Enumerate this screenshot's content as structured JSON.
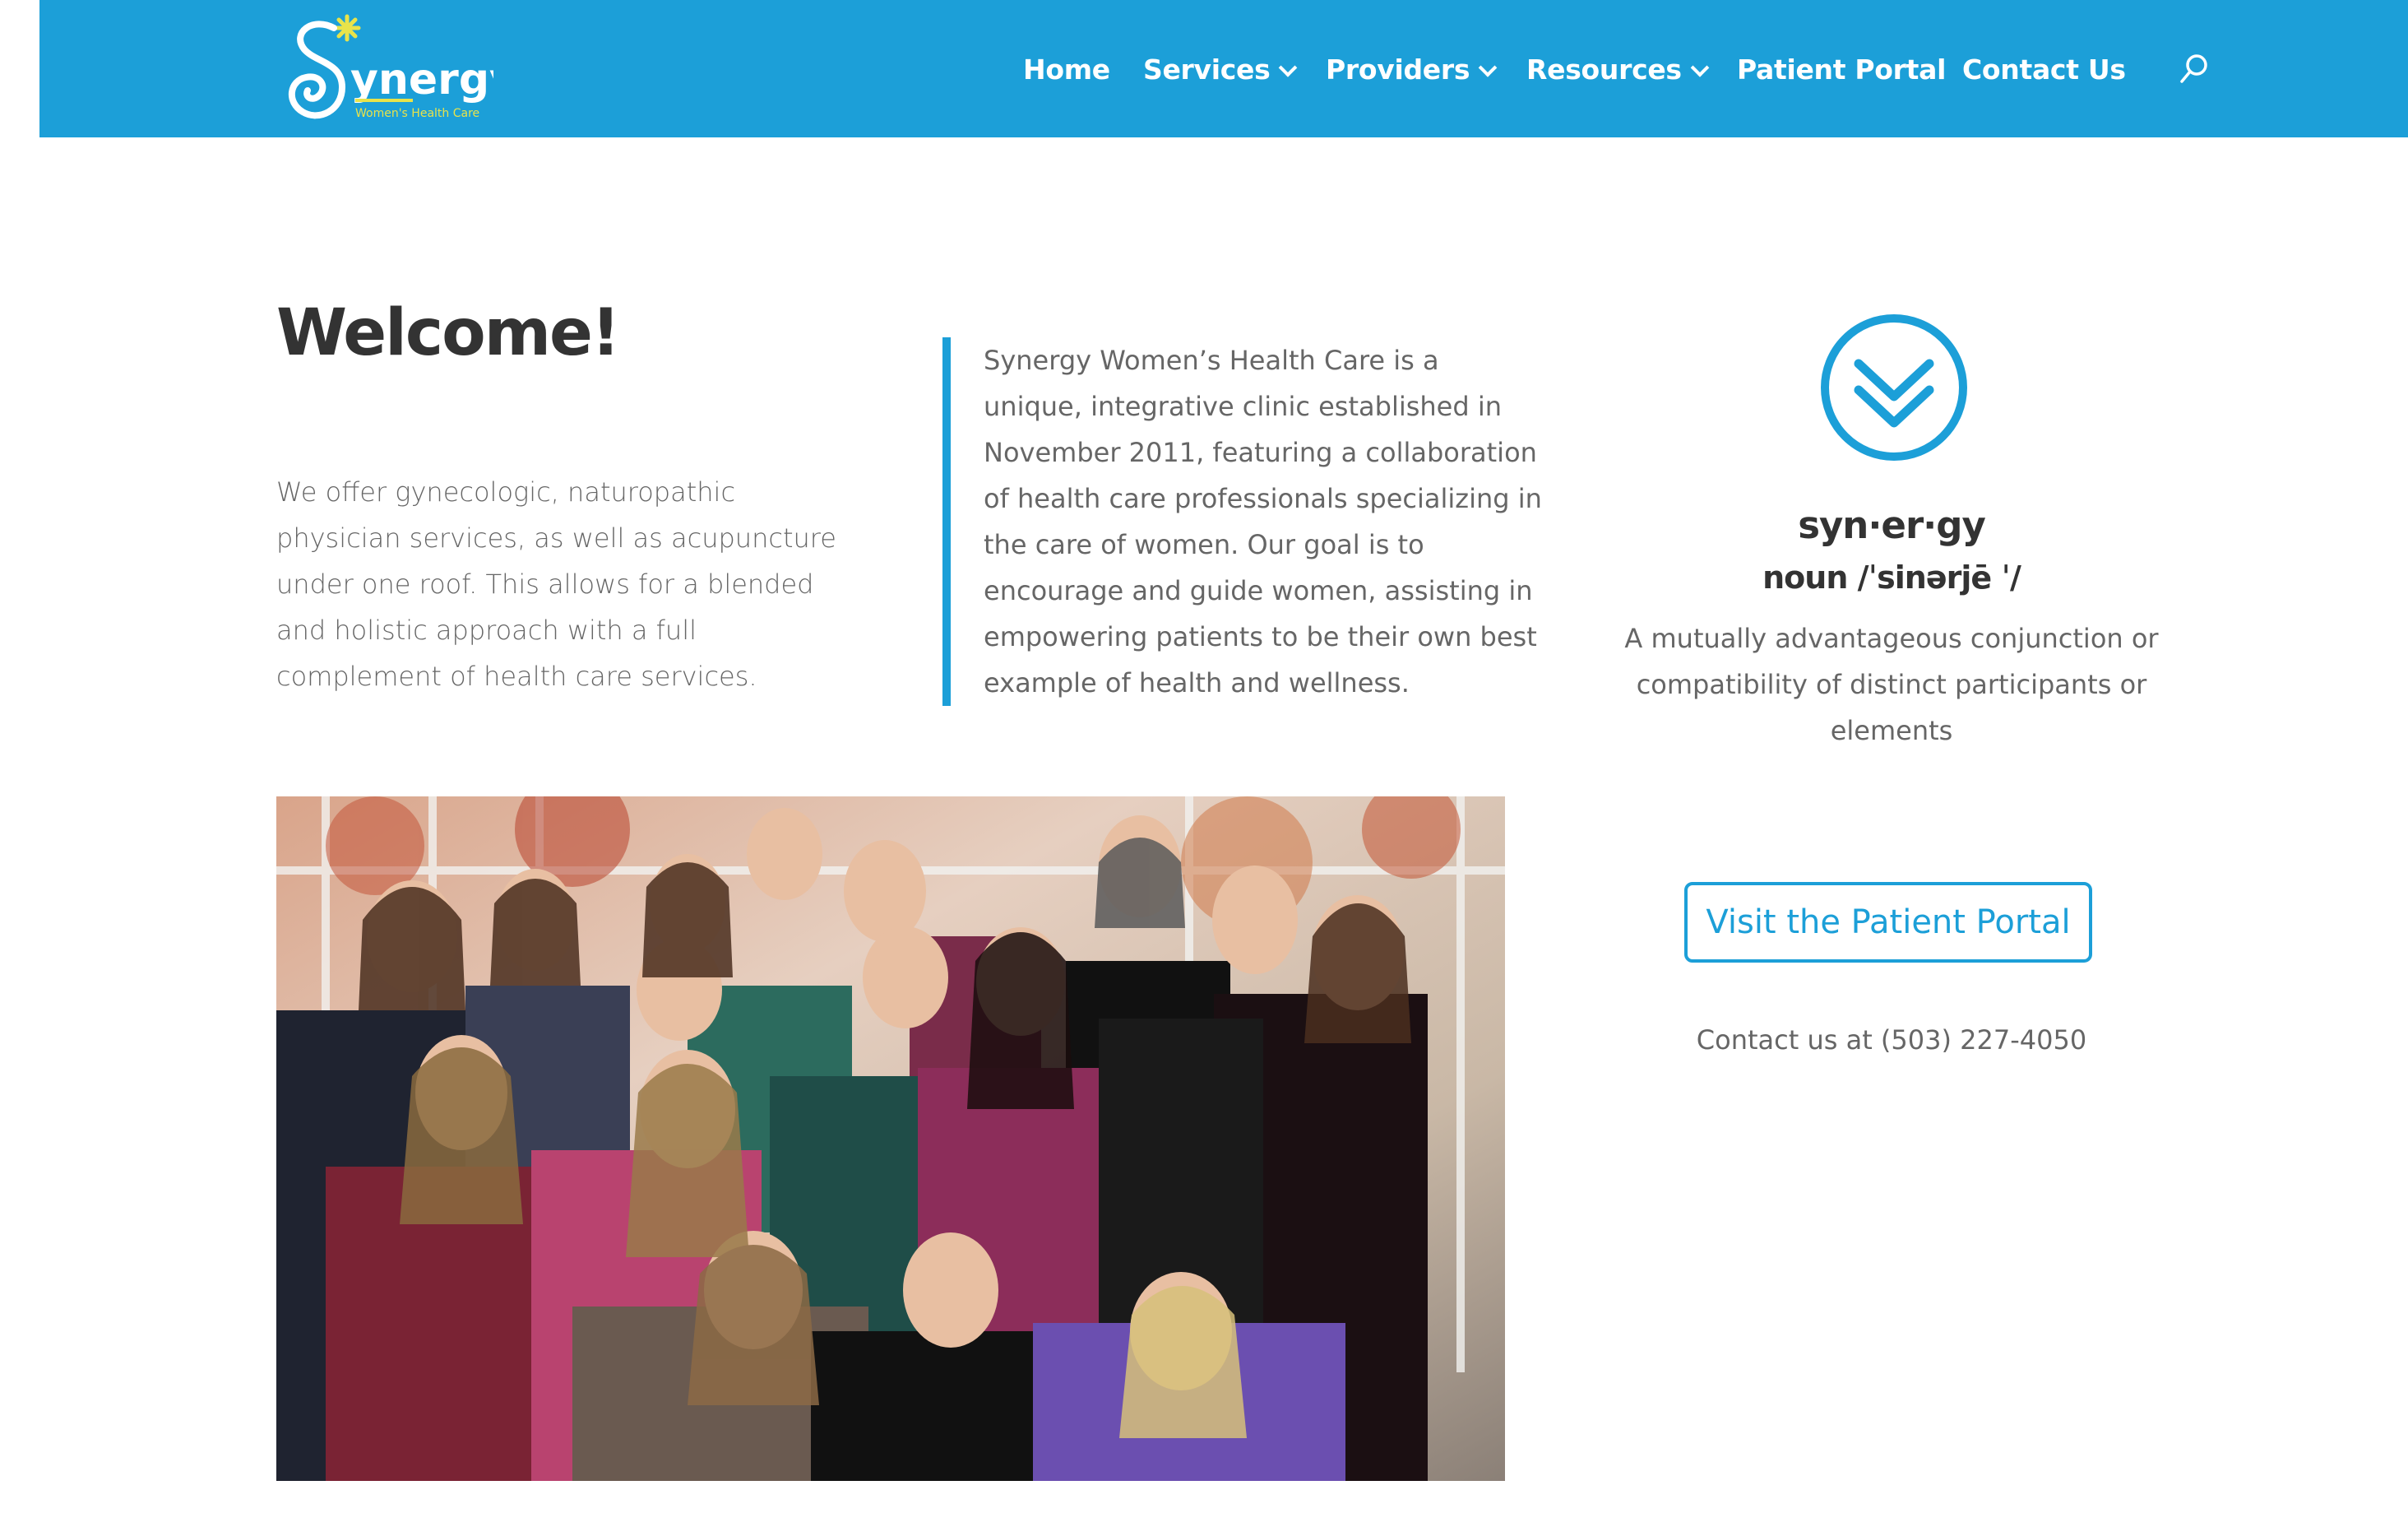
{
  "header": {
    "logo": {
      "wordmark": "ynergy",
      "tagline": "Women's Health Care"
    },
    "nav": [
      {
        "label": "Home",
        "has_dropdown": false
      },
      {
        "label": "Services",
        "has_dropdown": true
      },
      {
        "label": "Providers",
        "has_dropdown": true
      },
      {
        "label": "Resources",
        "has_dropdown": true
      },
      {
        "label": "Patient Portal",
        "has_dropdown": false
      },
      {
        "label": "Contact Us",
        "has_dropdown": false
      }
    ],
    "search_icon": "search-icon"
  },
  "welcome": {
    "heading": "Welcome!",
    "intro": "We offer gynecologic, naturopathic physician services, as well as acupuncture under one roof. This allows for a blended and holistic approach with a full complement of health care services."
  },
  "about": {
    "text": "Synergy Women’s Health Care is a unique, integrative clinic established in November 2011, featuring a collaboration of health care professionals specializing in the care of women. Our goal is to encourage and guide women, assisting in empowering patients to be their own best example of health and wellness."
  },
  "definition": {
    "icon": "double-chevron-down-circle-icon",
    "word": "syn·er·gy",
    "pronunciation": "noun /ˈsinərjē ˈ/",
    "meaning": "A mutually advantageous conjunction or compatibility of distinct participants or elements"
  },
  "cta": {
    "portal_button": "Visit the Patient Portal",
    "contact": "Contact us at (503) 227-4050"
  },
  "colors": {
    "brand_blue": "#1c9fd8",
    "heading": "#333333",
    "body_text": "#666666"
  }
}
